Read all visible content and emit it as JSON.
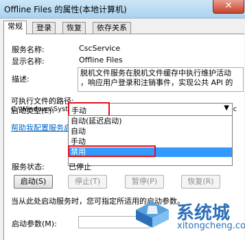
{
  "window": {
    "title": "Offline Files 的属性(本地计算机)",
    "close_label": "✕"
  },
  "tabs": [
    {
      "label": "常规",
      "active": true
    },
    {
      "label": "登录",
      "active": false
    },
    {
      "label": "恢复",
      "active": false
    },
    {
      "label": "依存关系",
      "active": false
    }
  ],
  "general": {
    "service_name_label": "服务名称:",
    "service_name_value": "CscService",
    "display_name_label": "显示名称:",
    "display_name_value": "Offline Files",
    "description_label": "描述:",
    "description_lines": [
      "脱机文件服务在脱机文件缓存中执行维护活动",
      "，响应用户登录和注销事件，实现公共 API 的"
    ],
    "exe_path_label": "可执行文件的路径:",
    "exe_path_value": "C:\\Windows\\System32\\svchost.exe -k LocalSystemNetworkRestric",
    "startup_type_label": "启动类型(E):",
    "startup_type_value": "手动",
    "startup_options": [
      "自动(延迟启动)",
      "自动",
      "手动",
      "禁用"
    ],
    "startup_selected": "禁用",
    "help_link": "帮助我配置服务启",
    "service_status_label": "服务状态:",
    "service_status_value": "已停止",
    "buttons": {
      "start": "启动(S)",
      "stop": "停止(T)",
      "pause": "暂停(P)",
      "resume": "恢复(R)"
    },
    "hint": "当从此处启动服务时，您可指定所适用的启动参数。",
    "params_label": "启动参数(M):"
  },
  "watermark": {
    "brand": "系统城",
    "url": "xitongcheng.com"
  },
  "colors": {
    "highlight": "#e0101a",
    "selection": "#3399ff",
    "link": "#0066cc",
    "watermark": "#2b6fb8"
  }
}
